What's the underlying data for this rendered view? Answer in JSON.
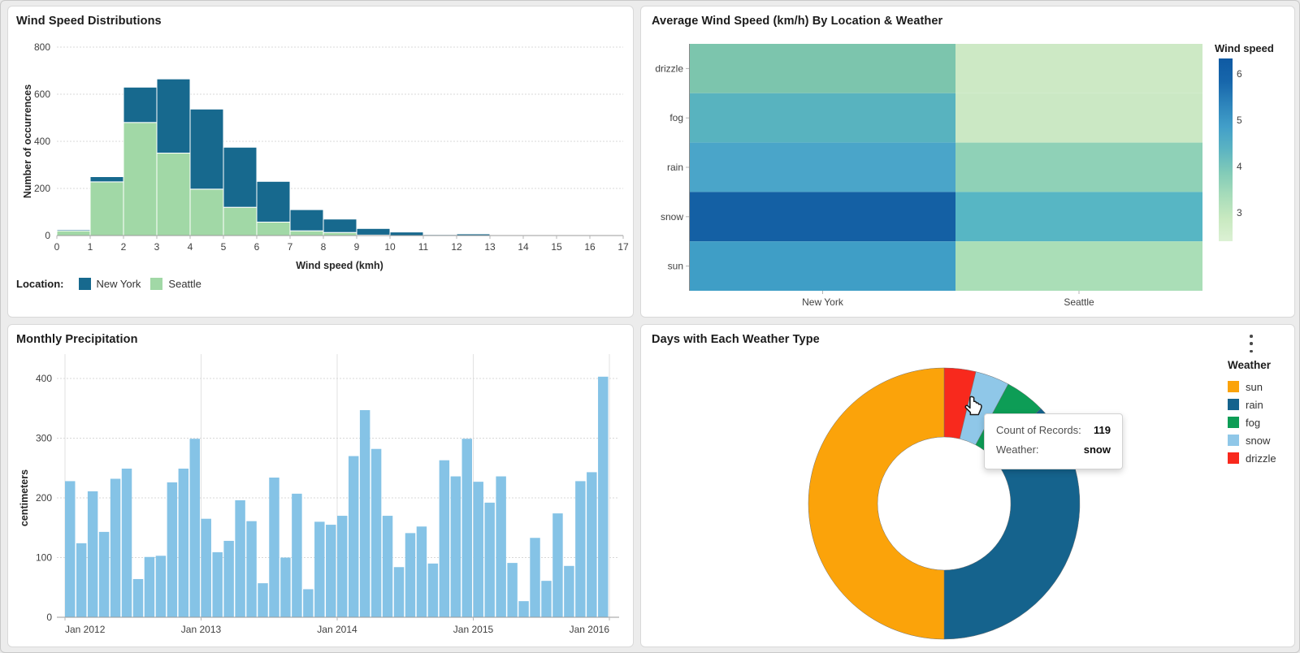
{
  "page": {
    "background": "#ececec",
    "card_border": "#d9d9d9"
  },
  "icons": {
    "menu": "kebab-vertical-icon",
    "cursor": "hand-pointer-cursor"
  },
  "chart_data": [
    {
      "id": "wind_speed_histogram",
      "type": "bar",
      "title": "Wind Speed Distributions",
      "xlabel": "Wind speed (kmh)",
      "ylabel": "Number of occurrences",
      "x_ticks": [
        0,
        1,
        2,
        3,
        4,
        5,
        6,
        7,
        8,
        9,
        10,
        11,
        12,
        13,
        14,
        15,
        16,
        17
      ],
      "ylim": [
        0,
        800
      ],
      "y_ticks": [
        0,
        200,
        400,
        600,
        800
      ],
      "stacked": true,
      "legend_title": "Location:",
      "legend_order": [
        "New York",
        "Seattle"
      ],
      "series": [
        {
          "name": "Seattle",
          "color": "#a1d8a6",
          "values": [
            22,
            228,
            480,
            350,
            197,
            120,
            57,
            20,
            13,
            2,
            0,
            0,
            0,
            0,
            0,
            0,
            0
          ]
        },
        {
          "name": "New York",
          "color": "#17698e",
          "values": [
            3,
            22,
            150,
            315,
            340,
            255,
            173,
            90,
            57,
            28,
            15,
            4,
            7,
            0,
            0,
            0,
            2
          ]
        }
      ]
    },
    {
      "id": "avg_wind_heatmap",
      "type": "heatmap",
      "title": "Average Wind Speed (km/h) By Location & Weather",
      "rows": [
        "drizzle",
        "fog",
        "rain",
        "snow",
        "sun"
      ],
      "columns": [
        "New York",
        "Seattle"
      ],
      "values": [
        [
          4.2,
          2.7
        ],
        [
          4.6,
          2.8
        ],
        [
          5.0,
          4.0
        ],
        [
          6.3,
          4.6
        ],
        [
          4.9,
          3.1
        ]
      ],
      "cell_colors": [
        [
          "#7cc5ad",
          "#cde9c5"
        ],
        [
          "#58b3bf",
          "#cbe8c4"
        ],
        [
          "#4aa5c9",
          "#8fd1b7"
        ],
        [
          "#1460a4",
          "#57b6c4"
        ],
        [
          "#3f9ec6",
          "#aadeb7"
        ]
      ],
      "legend": {
        "title": "Wind speed",
        "ticks": [
          3,
          4,
          5,
          6
        ],
        "domain": [
          2.4,
          6.35
        ],
        "gradient_bottom_to_top": [
          "#dcf1d4",
          "#c8e9c0",
          "#a7dcba",
          "#82cbb8",
          "#5cb4c2",
          "#429fc9",
          "#2d84bb",
          "#1766ab",
          "#0f5aa3"
        ]
      }
    },
    {
      "id": "monthly_precipitation",
      "type": "bar",
      "title": "Monthly Precipitation",
      "xlabel": "",
      "ylabel": "centimeters",
      "x_ticks": [
        "Jan 2012",
        "Jan 2013",
        "Jan 2014",
        "Jan 2015",
        "Jan 2016"
      ],
      "ylim": [
        0,
        400
      ],
      "y_ticks": [
        0,
        100,
        200,
        300,
        400
      ],
      "bar_color": "#85c3e6",
      "start_month": "Jan 2012",
      "values": [
        228,
        124,
        211,
        143,
        232,
        249,
        64,
        101,
        103,
        226,
        249,
        299,
        165,
        109,
        128,
        196,
        161,
        57,
        234,
        100,
        207,
        47,
        160,
        155,
        170,
        270,
        347,
        282,
        170,
        84,
        141,
        152,
        90,
        263,
        236,
        299,
        227,
        192,
        236,
        91,
        27,
        133,
        61,
        174,
        86,
        228,
        243,
        403
      ]
    },
    {
      "id": "weather_type_donut",
      "type": "pie",
      "title": "Days with Each Weather Type",
      "legend_title": "Weather",
      "segments": [
        {
          "label": "drizzle",
          "value": 110,
          "color": "#f8291d"
        },
        {
          "label": "snow",
          "value": 119,
          "color": "#8fc7e8"
        },
        {
          "label": "fog",
          "value": 140,
          "color": "#0d9d56"
        },
        {
          "label": "rain",
          "value": 1092,
          "color": "#15638d"
        },
        {
          "label": "sun",
          "value": 1461,
          "color": "#fba30a"
        }
      ],
      "legend_order": [
        "sun",
        "rain",
        "fog",
        "snow",
        "drizzle"
      ],
      "tooltip": {
        "rows": [
          {
            "label": "Count of Records:",
            "value": "119"
          },
          {
            "label": "Weather:",
            "value": "snow"
          }
        ]
      }
    }
  ]
}
